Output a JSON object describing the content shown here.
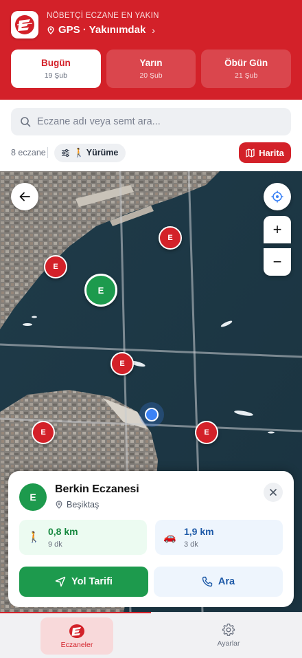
{
  "header": {
    "subtitle": "NÖBETÇİ ECZANE EN YAKIN",
    "location": "GPS · Yakınımdak",
    "chevron": "›",
    "logo_letter": "E"
  },
  "day_tabs": [
    {
      "label": "Bugün",
      "date": "19 Şub",
      "active": true
    },
    {
      "label": "Yarın",
      "date": "20 Şub",
      "active": false
    },
    {
      "label": "Öbür Gün",
      "date": "21 Şub",
      "active": false
    }
  ],
  "search": {
    "placeholder": "Eczane adı veya semt ara..."
  },
  "filters": {
    "count": "8 eczane",
    "mode": "🚶 Yürüme",
    "map_button": "Harita"
  },
  "map": {
    "zoom_in": "+",
    "zoom_out": "−",
    "pin_letter": "E",
    "pins": [
      {
        "letter": "E",
        "selected": false
      },
      {
        "letter": "E",
        "selected": false
      },
      {
        "letter": "E",
        "selected": true
      },
      {
        "letter": "E",
        "selected": false
      },
      {
        "letter": "E",
        "selected": false
      },
      {
        "letter": "E",
        "selected": false
      }
    ]
  },
  "card": {
    "avatar": "E",
    "name": "Berkin Eczanesi",
    "district": "Beşiktaş",
    "walk": {
      "icon": "🚶",
      "distance": "0,8 km",
      "duration": "9 dk"
    },
    "car": {
      "icon": "🚗",
      "distance": "1,9 km",
      "duration": "3 dk"
    },
    "route_button": "Yol Tarifi",
    "call_button": "Ara"
  },
  "nav": {
    "items": [
      {
        "label": "Eczaneler",
        "active": true
      },
      {
        "label": "Ayarlar",
        "active": false
      }
    ]
  },
  "colors": {
    "brand_red": "#d32129",
    "selected_green": "#1d9a4d",
    "call_blue": "#1e5aa8",
    "user_dot": "#3b82f6"
  },
  "icons": [
    "location-pin-icon",
    "search-icon",
    "sliders-icon",
    "map-icon",
    "arrow-left-icon",
    "crosshair-icon",
    "close-icon",
    "navigation-arrow-icon",
    "phone-icon",
    "gear-icon",
    "pharmacy-logo-icon"
  ]
}
